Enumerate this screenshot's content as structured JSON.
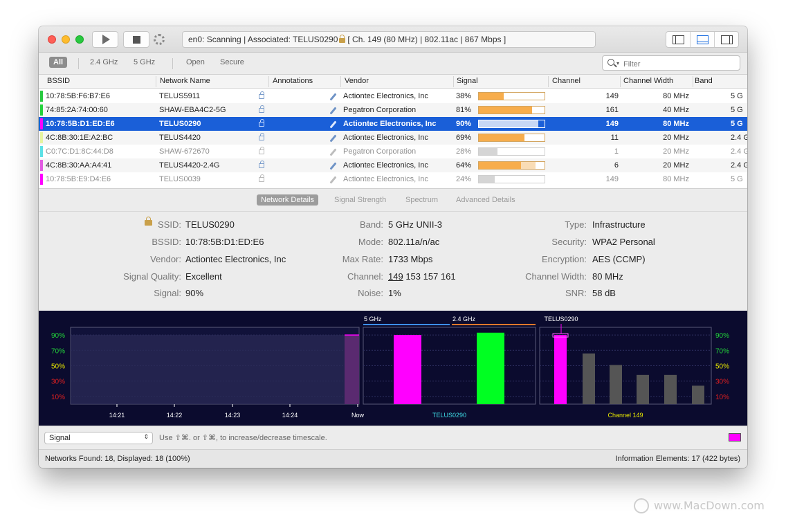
{
  "toolbar": {
    "status": "en0: Scanning  |  Associated: TELUS0290",
    "status_tail": "[ Ch. 149 (80 MHz) | 802.11ac | 867 Mbps ]"
  },
  "filters": {
    "all": "All",
    "g24": "2.4 GHz",
    "g5": "5 GHz",
    "open": "Open",
    "secure": "Secure",
    "search_placeholder": "Filter"
  },
  "columns": {
    "bssid": "BSSID",
    "name": "Network Name",
    "annotations": "Annotations",
    "vendor": "Vendor",
    "signal": "Signal",
    "channel": "Channel",
    "width": "Channel Width",
    "band": "Band"
  },
  "rows": [
    {
      "bssid": "10:78:5B:F6:B7:E6",
      "name": "TELUS5911",
      "vendor": "Actiontec Electronics, Inc",
      "signal": "38%",
      "signal_value": 38,
      "signal_mark": 38,
      "channel": "149",
      "width": "80 MHz",
      "band": "5 G",
      "color": "#27c93f"
    },
    {
      "bssid": "74:85:2A:74:00:60",
      "name": "SHAW-EBA4C2-5G",
      "vendor": "Pegatron Corporation",
      "signal": "81%",
      "signal_value": 81,
      "signal_mark": 81,
      "channel": "161",
      "width": "40 MHz",
      "band": "5 G",
      "color": "#22d23a"
    },
    {
      "bssid": "10:78:5B:D1:ED:E6",
      "name": "TELUS0290",
      "vendor": "Actiontec Electronics, Inc",
      "signal": "90%",
      "signal_value": 90,
      "signal_mark": 90,
      "channel": "149",
      "width": "80 MHz",
      "band": "5 G",
      "color": "#ff00ff"
    },
    {
      "bssid": "4C:8B:30:1E:A2:BC",
      "name": "TELUS4420",
      "vendor": "Actiontec Electronics, Inc",
      "signal": "69%",
      "signal_value": 69,
      "signal_mark": 69,
      "channel": "11",
      "width": "20 MHz",
      "band": "2.4 G",
      "color": "#e6f3a0"
    },
    {
      "bssid": "C0:7C:D1:8C:44:D8",
      "name": "SHAW-672670",
      "vendor": "Pegatron Corporation",
      "signal": "28%",
      "signal_value": 28,
      "signal_mark": 28,
      "channel": "1",
      "width": "20 MHz",
      "band": "2.4 G",
      "color": "#5ce1e6"
    },
    {
      "bssid": "4C:8B:30:AA:A4:41",
      "name": "TELUS4420-2.4G",
      "vendor": "Actiontec Electronics, Inc",
      "signal": "64%",
      "signal_value": 64,
      "signal_mark": 86,
      "channel": "6",
      "width": "20 MHz",
      "band": "2.4 G",
      "color": "#e25be2"
    },
    {
      "bssid": "10:78:5B:E9:D4:E6",
      "name": "TELUS0039",
      "vendor": "Actiontec Electronics, Inc",
      "signal": "24%",
      "signal_value": 24,
      "signal_mark": 24,
      "channel": "149",
      "width": "80 MHz",
      "band": "5 G",
      "color": "#ff00ff"
    }
  ],
  "tabs": [
    "Network Details",
    "Signal Strength",
    "Spectrum",
    "Advanced Details"
  ],
  "details": {
    "ssid_label": "SSID:",
    "ssid": "TELUS0290",
    "bssid_label": "BSSID:",
    "bssid": "10:78:5B:D1:ED:E6",
    "vendor_label": "Vendor:",
    "vendor": "Actiontec Electronics, Inc",
    "quality_label": "Signal Quality:",
    "quality": "Excellent",
    "signal_label": "Signal:",
    "signal": "90%",
    "band_label": "Band:",
    "band": "5 GHz UNII-3",
    "mode_label": "Mode:",
    "mode": "802.11a/n/ac",
    "maxrate_label": "Max Rate:",
    "maxrate": "1733 Mbps",
    "channel_label": "Channel:",
    "channel_primary": "149",
    "channel_rest": "153 157 161",
    "noise_label": "Noise:",
    "noise": "1%",
    "type_label": "Type:",
    "type": "Infrastructure",
    "security_label": "Security:",
    "security": "WPA2 Personal",
    "encryption_label": "Encryption:",
    "encryption": "AES (CCMP)",
    "chwidth_label": "Channel Width:",
    "chwidth": "80 MHz",
    "snr_label": "SNR:",
    "snr": "58 dB"
  },
  "graph": {
    "y_ticks": [
      "90%",
      "70%",
      "50%",
      "30%",
      "10%"
    ],
    "y_colors": [
      "#22d23a",
      "#22d23a",
      "#e6e600",
      "#e02020",
      "#e02020"
    ],
    "time_ticks": [
      "14:21",
      "14:22",
      "14:23",
      "14:24",
      "Now"
    ],
    "history_value": 90,
    "band_labels": {
      "g5": "5 GHz",
      "g24": "2.4 GHz"
    },
    "band_bars": [
      {
        "value": 90,
        "color": "#ff00ff"
      },
      {
        "value": 93,
        "color": "#00ff22"
      }
    ],
    "band_caption": "TELUS0290",
    "channel_title": "TELUS0290",
    "channel_bars": [
      {
        "value": 90,
        "color": "#ff00ff"
      },
      {
        "value": 66,
        "color": "#555555"
      },
      {
        "value": 51,
        "color": "#555555"
      },
      {
        "value": 38,
        "color": "#555555"
      },
      {
        "value": 38,
        "color": "#555555"
      },
      {
        "value": 24,
        "color": "#555555"
      }
    ],
    "channel_caption": "Channel 149"
  },
  "bottom": {
    "select_value": "Signal",
    "hint": "Use ⇧⌘. or ⇧⌘, to increase/decrease timescale.",
    "swatch_color": "#ff00ff"
  },
  "status": {
    "left": "Networks Found: 18, Displayed: 18 (100%)",
    "right": "Information Elements: 17 (422 bytes)"
  },
  "watermark": "www.MacDown.com"
}
